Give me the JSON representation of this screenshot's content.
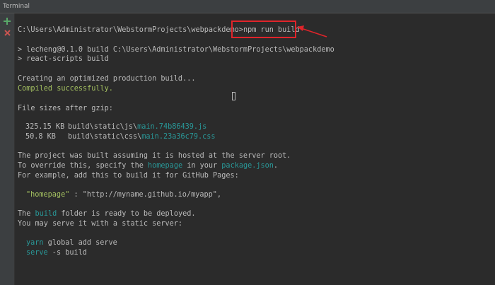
{
  "window": {
    "title": "Terminal"
  },
  "toolbar": {
    "new_session_icon": "plus-icon",
    "close_session_icon": "close-icon"
  },
  "terminal": {
    "prompt": "C:\\Users\\Administrator\\WebstormProjects\\webpackdemo>",
    "command": "npm run build",
    "script_line_1": "> lecheng@0.1.0 build C:\\Users\\Administrator\\WebstormProjects\\webpackdemo",
    "script_line_2": "> react-scripts build",
    "creating": "Creating an optimized production build...",
    "compiled": "Compiled successfully.",
    "sizes_header": "File sizes after gzip:",
    "files": [
      {
        "size": "325.15 KB",
        "dir": "build\\static\\js\\",
        "name": "main.74b86439.js"
      },
      {
        "size": "50.8 KB",
        "dir": "build\\static\\css\\",
        "name": "main.23a36c79.css"
      }
    ],
    "hosted_line": "The project was built assuming it is hosted at the server root.",
    "override_prefix": "To override this, specify the ",
    "override_homepage": "homepage",
    "override_middle": " in your ",
    "override_package": "package.json",
    "override_suffix": ".",
    "example_line": "For example, add this to build it for GitHub Pages:",
    "homepage_key": "\"homepage\"",
    "homepage_rest": " : \"http://myname.github.io/myapp\",",
    "build_prefix": "The ",
    "build_word": "build",
    "build_suffix": " folder is ready to be deployed.",
    "serve_line": "You may serve it with a static server:",
    "cmd1_word": "yarn",
    "cmd1_rest": " global add serve",
    "cmd2_word": "serve",
    "cmd2_rest": " -s build"
  },
  "colors": {
    "background": "#2b2b2b",
    "text": "#bbbbbb",
    "success": "#a5c261",
    "highlight": "#299999",
    "annotation": "#e0242a"
  }
}
